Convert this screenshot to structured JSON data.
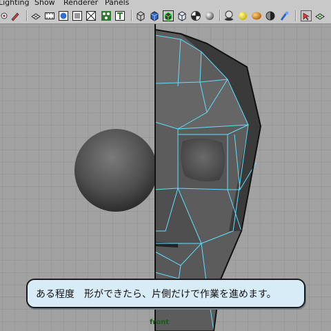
{
  "menu": {
    "items": [
      "Lighting",
      "Show",
      "Renderer",
      "Panels"
    ]
  },
  "toolbar": {
    "icons": [
      "select-camera-icon",
      "bookmark-pencil-icon",
      "grid-icon",
      "film-gate-icon",
      "resolution-gate-icon",
      "gate-mask-icon",
      "field-chart-icon",
      "safe-action-icon",
      "safe-title-icon",
      "wireframe-cube-icon",
      "smooth-shade-cube-icon",
      "wireframe-on-shaded-icon",
      "bounding-box-cube-icon",
      "textured-checker-icon",
      "default-lighting-icon",
      "shadows-icon",
      "hardware-texture-icon",
      "backface-icon",
      "xray-icon",
      "isolate-select-icon"
    ]
  },
  "viewport": {
    "camera": "front"
  },
  "caption": {
    "text": "ある程度　形ができたら、片側だけで作業を進めます。"
  },
  "colors": {
    "background": "#a2a2a2",
    "grid": "#8f8f8f",
    "wire_highlight": "#5fe0ff",
    "mesh_face": "#5a5a5a",
    "caption_fill": "#d8ecf8"
  }
}
